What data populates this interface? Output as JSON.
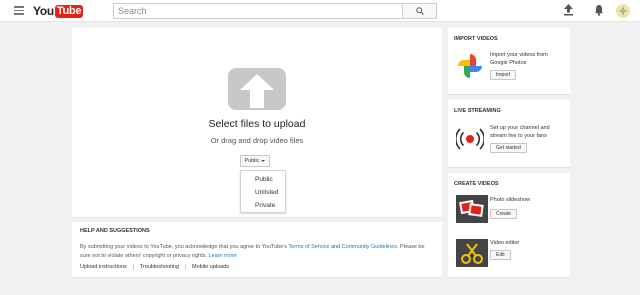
{
  "header": {
    "logo_you": "You",
    "logo_tube": "Tube",
    "search_placeholder": "Search"
  },
  "upload": {
    "title": "Select files to upload",
    "subtitle": "Or drag and drop video files",
    "privacy_selected": "Public",
    "privacy_options": [
      "Public",
      "Unlisted",
      "Private"
    ]
  },
  "help": {
    "title": "HELP AND SUGGESTIONS",
    "text_before": "By submitting your videos to YouTube, you acknowledge that you agree to YouTube's ",
    "tos_link": "Terms of Service",
    "text_and": " and ",
    "guidelines_link": "Community Guidelines",
    "text_mid": ". Please be sure not to violate others' copyright or privacy rights. ",
    "learn_more": "Learn more",
    "links": [
      "Upload instructions",
      "Troubleshooting",
      "Mobile uploads"
    ]
  },
  "import": {
    "title": "IMPORT VIDEOS",
    "text": "Import your videos from Google Photos",
    "button": "Import"
  },
  "live": {
    "title": "LIVE STREAMING",
    "text": "Set up your channel and stream live to your fans",
    "button": "Get started"
  },
  "create": {
    "title": "CREATE VIDEOS",
    "slideshow_label": "Photo slideshow",
    "slideshow_button": "Create",
    "editor_label": "Video editor",
    "editor_button": "Edit"
  },
  "colors": {
    "brand_red": "#e62117",
    "link_blue": "#167ac6",
    "background": "#f1f1f1"
  }
}
